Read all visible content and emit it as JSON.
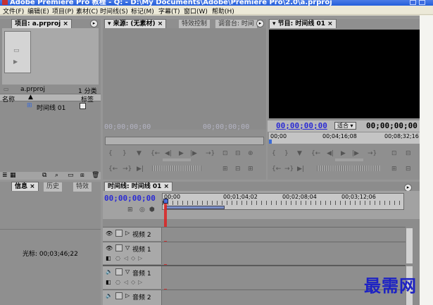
{
  "window": {
    "title": "Adobe Premiere Pro 教程 - Q: - D:\\My Documents\\Adobe\\Premiere Pro\\2.0\\a.prproj"
  },
  "menu": {
    "items": [
      "文件(F)",
      "编辑(E)",
      "项目(P)",
      "素材(C)",
      "时间线(S)",
      "标记(M)",
      "字幕(T)",
      "窗口(W)",
      "帮助(H)"
    ]
  },
  "project_panel": {
    "tab": "项目: a.prproj",
    "file_name": "a.prproj",
    "item_count": "1 分类",
    "col_name": "名称",
    "col_label": "标签",
    "items": [
      {
        "name": "时间线 01"
      }
    ]
  },
  "source_panel": {
    "tabs": [
      "来源: (无素材)",
      "特效控制",
      "调音台: 时间"
    ],
    "timecode_left": "00;00;00;00",
    "timecode_right": "00;00;00;00"
  },
  "program_panel": {
    "tab": "节目: 时间线 01",
    "timecode_left": "00;00;00;00",
    "fit_label": "适合",
    "timecode_right": "00;00;00;00",
    "ruler": [
      "00;00",
      "00;04;16;08",
      "00;08;32;16"
    ]
  },
  "info_panel": {
    "tabs": [
      "信息",
      "历史",
      "特效"
    ],
    "cursor_label": "光标: 00;03;46;22"
  },
  "timeline": {
    "tab": "时间线: 时间线 01",
    "timecode": "00;00;00;00",
    "ruler": [
      "00;00",
      "00;01;04;02",
      "00;02;08;04",
      "00;03;12;06"
    ],
    "tracks": [
      {
        "name": "视频 2",
        "type": "video"
      },
      {
        "name": "视频 1",
        "type": "video"
      },
      {
        "name": "音频 1",
        "type": "audio"
      },
      {
        "name": "音频 2",
        "type": "audio"
      }
    ]
  },
  "watermark": "最需网"
}
